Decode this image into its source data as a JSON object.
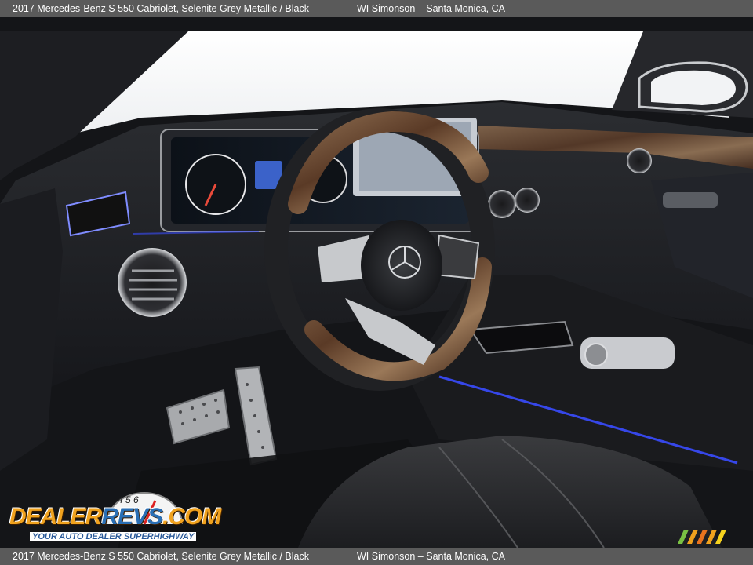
{
  "caption": {
    "title": "2017 Mercedes-Benz S 550 Cabriolet,  Selenite Grey Metallic / Black",
    "dealer": "WI Simonson – Santa Monica, CA"
  },
  "watermark": {
    "brand_dealer": "DEALER",
    "brand_revs": "REVS",
    "brand_com": ".COM",
    "tagline": "YOUR AUTO DEALER SUPERHIGHWAY",
    "gauge_digits": "4 5 6"
  },
  "colors": {
    "caption_bar": "#5a5a5a",
    "logo_orange": "#f0a21e",
    "logo_blue": "#2a6fb5",
    "ambient_blue": "#3a4dff",
    "wood_trim": "#6b4a30"
  },
  "scene": {
    "subject": "Mercedes-Benz S 550 Cabriolet interior, driver side dashboard view",
    "icons": [
      "steering-wheel-icon",
      "mercedes-star-icon",
      "round-air-vent-icon",
      "pedal-icon",
      "gear-selector-icon"
    ]
  }
}
